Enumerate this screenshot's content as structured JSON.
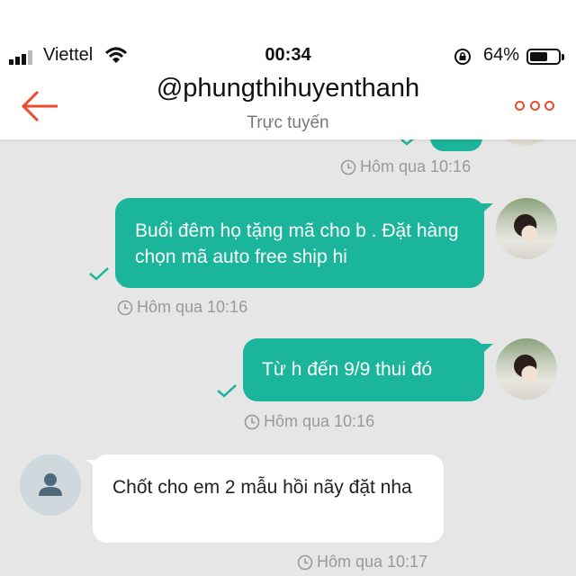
{
  "status_bar": {
    "carrier": "Viettel",
    "time": "00:34",
    "battery_percent": "64%",
    "battery_level": 0.64
  },
  "header": {
    "title": "@phungthihuyenthanh",
    "subtitle": "Trực tuyến"
  },
  "colors": {
    "accent": "#ee4d2d",
    "outgoing_bubble": "#1ab59a",
    "background": "#e6e6e6"
  },
  "messages": [
    {
      "direction": "outgoing",
      "text": "",
      "time": "Hôm qua 10:16",
      "status": "sent",
      "partial": true
    },
    {
      "direction": "outgoing",
      "text": "Buổi đêm họ tặng mã cho b . Đặt hàng chọn mã auto free ship hi",
      "time": "Hôm qua 10:16",
      "status": "sent"
    },
    {
      "direction": "outgoing",
      "text": "Từ h đến 9/9 thui đó",
      "time": "Hôm qua 10:16",
      "status": "sent"
    },
    {
      "direction": "incoming",
      "text": "Chốt cho em 2 mẫu hồi nãy đặt nha",
      "time": "Hôm qua 10:17"
    }
  ]
}
